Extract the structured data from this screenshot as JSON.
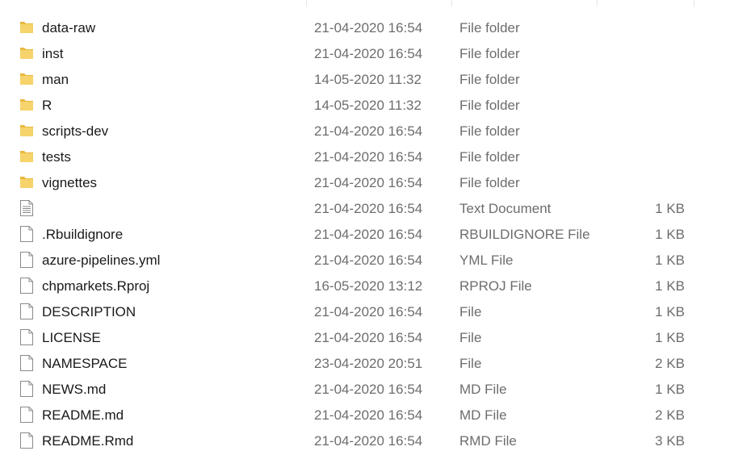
{
  "files": [
    {
      "name": "data-raw",
      "date": "21-04-2020 16:54",
      "type": "File folder",
      "size": "",
      "icon": "folder-icon"
    },
    {
      "name": "inst",
      "date": "21-04-2020 16:54",
      "type": "File folder",
      "size": "",
      "icon": "folder-icon"
    },
    {
      "name": "man",
      "date": "14-05-2020 11:32",
      "type": "File folder",
      "size": "",
      "icon": "folder-icon"
    },
    {
      "name": "R",
      "date": "14-05-2020 11:32",
      "type": "File folder",
      "size": "",
      "icon": "folder-icon"
    },
    {
      "name": "scripts-dev",
      "date": "21-04-2020 16:54",
      "type": "File folder",
      "size": "",
      "icon": "folder-icon"
    },
    {
      "name": "tests",
      "date": "21-04-2020 16:54",
      "type": "File folder",
      "size": "",
      "icon": "folder-icon"
    },
    {
      "name": "vignettes",
      "date": "21-04-2020 16:54",
      "type": "File folder",
      "size": "",
      "icon": "folder-icon"
    },
    {
      "name": "",
      "date": "21-04-2020 16:54",
      "type": "Text Document",
      "size": "1 KB",
      "icon": "text-document-icon"
    },
    {
      "name": ".Rbuildignore",
      "date": "21-04-2020 16:54",
      "type": "RBUILDIGNORE File",
      "size": "1 KB",
      "icon": "file-icon"
    },
    {
      "name": "azure-pipelines.yml",
      "date": "21-04-2020 16:54",
      "type": "YML File",
      "size": "1 KB",
      "icon": "file-icon"
    },
    {
      "name": "chpmarkets.Rproj",
      "date": "16-05-2020 13:12",
      "type": "RPROJ File",
      "size": "1 KB",
      "icon": "file-icon"
    },
    {
      "name": "DESCRIPTION",
      "date": "21-04-2020 16:54",
      "type": "File",
      "size": "1 KB",
      "icon": "file-icon"
    },
    {
      "name": "LICENSE",
      "date": "21-04-2020 16:54",
      "type": "File",
      "size": "1 KB",
      "icon": "file-icon"
    },
    {
      "name": "NAMESPACE",
      "date": "23-04-2020 20:51",
      "type": "File",
      "size": "2 KB",
      "icon": "file-icon"
    },
    {
      "name": "NEWS.md",
      "date": "21-04-2020 16:54",
      "type": "MD File",
      "size": "1 KB",
      "icon": "file-icon"
    },
    {
      "name": "README.md",
      "date": "21-04-2020 16:54",
      "type": "MD File",
      "size": "2 KB",
      "icon": "file-icon"
    },
    {
      "name": "README.Rmd",
      "date": "21-04-2020 16:54",
      "type": "RMD File",
      "size": "3 KB",
      "icon": "file-icon"
    }
  ],
  "colors": {
    "folder": "#f6d36b",
    "folder_dark": "#e8b93e",
    "file_outline": "#8a8a8a",
    "text_primary": "#1a1a1a",
    "text_secondary": "#6d6d6d"
  }
}
